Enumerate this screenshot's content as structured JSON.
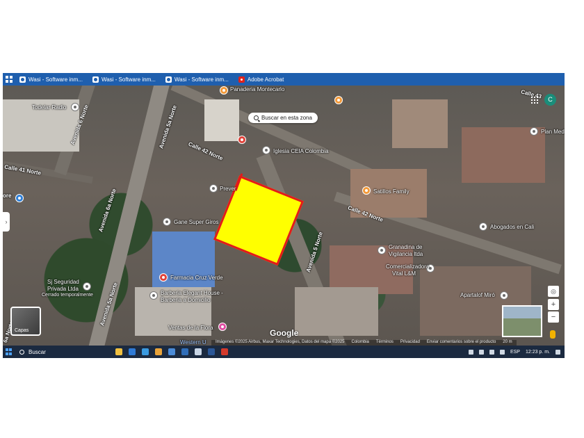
{
  "topbar": {
    "tabs": [
      {
        "label": "Wasi - Software inm..."
      },
      {
        "label": "Wasi - Software inm..."
      },
      {
        "label": "Wasi - Software inm..."
      },
      {
        "label": "Adobe Acrobat"
      }
    ]
  },
  "map": {
    "search_area_label": "Buscar en esta zona",
    "avatar_letter": "C",
    "layers_label": "Capas",
    "google_logo": "Google",
    "roads": {
      "avenida_6_norte": "Avenida 6 Norte",
      "avenida_5a_norte": "Avenida 5a Norte",
      "avenida_5a_norte_lower": "Avenida 5a Norte",
      "avenida_6a_norte": "Avenida 6a Norte",
      "calle_42_norte": "Calle 42 Norte",
      "calle_42_norte_east": "Calle 42 Norte",
      "calle_41_norte": "Calle 41 Norte",
      "avenida_5_norte": "Avenida 5 Norte",
      "calle_43": "Calle 43",
      "left_edge_a": "6a Norte",
      "left_edge_b": "ore"
    },
    "places": {
      "todelar_radio": "Todelar Radio",
      "panaderia": "Panaderia Montecarlo",
      "iglesia": "Iglesia CEIA Colombia",
      "prever": "Prever",
      "gane": "Gane Super Giros",
      "farmacia": "Farmacia Cruz Verde",
      "barberia_1": "Barberia Elegant House -",
      "barberia_2": "Barberia a Domicilio",
      "ventas": "Ventas de la Flora",
      "satillos": "Satillos Family",
      "plan_medi": "Plan Medi",
      "abogados": "Abogados en Cali",
      "granadina_1": "Granadina de",
      "granadina_2": "Vigilancia ltda",
      "comercializadora_1": "Comercializadora",
      "comercializadora_2": "Vital L&M",
      "apartalof": "Apartalof Miró",
      "sj_1": "Sj Seguridad",
      "sj_2": "Privada Ltda",
      "sj_3": "Cerrado temporalmente",
      "western": "Western U"
    },
    "attribution": {
      "imagery": "Imágenes ©2025 Airbus, Maxar Technologies, Datos del mapa ©2025",
      "country": "Colombia",
      "terms": "Términos",
      "privacy": "Privacidad",
      "feedback": "Enviar comentarios sobre el producto",
      "scale": "20 m"
    },
    "parcel_color": "#ffff00",
    "parcel_border": "#e21b1b"
  },
  "taskbar": {
    "search_label": "Buscar",
    "language": "ESP",
    "time": "12:23 p. m."
  }
}
